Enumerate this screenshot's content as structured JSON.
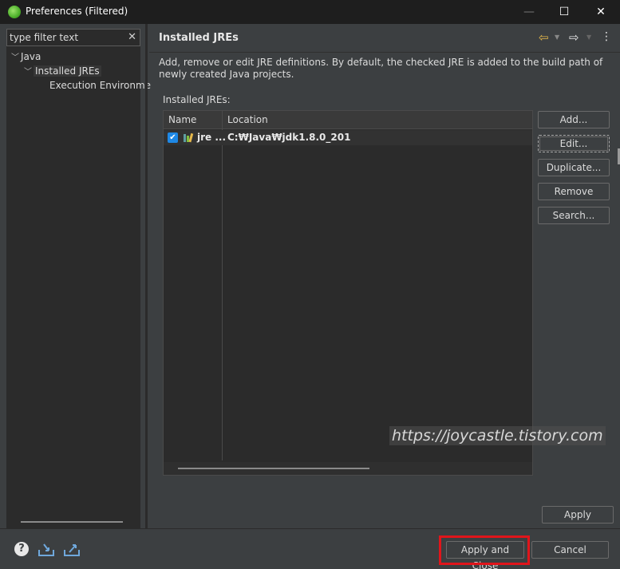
{
  "window": {
    "title": "Preferences (Filtered)",
    "minimize_glyph": "—",
    "maximize_glyph": "☐",
    "close_glyph": "✕"
  },
  "left": {
    "filter_placeholder": "type filter text",
    "filter_value": "",
    "tree": [
      {
        "label": "Java",
        "expanded": true
      },
      {
        "label": "Installed JREs",
        "expanded": true,
        "selected": true
      },
      {
        "label": "Execution Environme"
      }
    ]
  },
  "header": {
    "title": "Installed JREs",
    "back_icon": "arrow-left-icon",
    "forward_icon": "arrow-right-icon",
    "menu_icon": "view-menu-icon"
  },
  "description": "Add, remove or edit JRE definitions. By default, the checked JRE is added to the build path of newly created Java projects.",
  "jres": {
    "label": "Installed JREs:",
    "columns": [
      "Name",
      "Location"
    ],
    "rows": [
      {
        "checked": true,
        "name": "jre ...",
        "location": "C:₩Java₩jdk1.8.0_201"
      }
    ]
  },
  "buttons": {
    "add": "Add...",
    "edit": "Edit...",
    "duplicate": "Duplicate...",
    "remove": "Remove",
    "search": "Search...",
    "apply": "Apply",
    "apply_close": "Apply and Close",
    "cancel": "Cancel"
  },
  "watermark": "https://joycastle.tistory.com",
  "colors": {
    "background": "#3c3f41",
    "panel": "#2b2b2b",
    "checkbox": "#1e88e5",
    "highlight": "#e0151b"
  }
}
